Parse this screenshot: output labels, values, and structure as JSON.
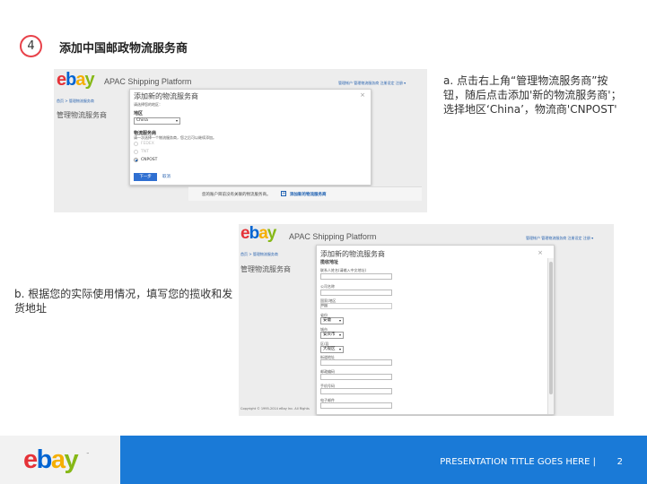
{
  "step": {
    "number": "4",
    "title": "添加中国邮政物流服务商"
  },
  "screenshot1": {
    "logo": {
      "e": "e",
      "b": "b",
      "a": "a",
      "y": "y"
    },
    "platform_name": "APAC Shipping Platform",
    "top_links": "管理帐户   管理物流服务商   注册设定   注册 ▾",
    "breadcrumb": "首页 > 管理物流服务商",
    "page_heading": "管理物流服务商",
    "modal": {
      "title": "添加新的物流服务商",
      "close": "×",
      "hint": "请选择您的地区：",
      "region_label": "地区",
      "region_value": "China",
      "provider_label": "物流服务商",
      "provider_hint": "请一次选择一个物流服务商，您之后可以继续添加。",
      "options": [
        {
          "label": "FEDEX",
          "state": "disabled"
        },
        {
          "label": "TNT",
          "state": "disabled"
        },
        {
          "label": "CNPOST",
          "state": "selected"
        }
      ],
      "next_button": "下一步",
      "cancel_button": "取消"
    },
    "footer_text": "您的账户目前没有关联的物流服务商。",
    "footer_link": "添加新的物流服务商",
    "footer_plus": "+"
  },
  "screenshot2": {
    "logo": {
      "e": "e",
      "b": "b",
      "a": "a",
      "y": "y"
    },
    "platform_name": "APAC Shipping Platform",
    "top_links": "管理帐户   管理物流服务商   注册设定   注册 ▾",
    "breadcrumb": "首页 > 管理物流服务商",
    "page_heading": "管理物流服务商",
    "modal": {
      "title": "添加新的物流服务商",
      "close": "×",
      "section_heading": "揽收地址",
      "field_contact": "联系人姓名(请输入中文地址)",
      "field_company": "公司名称",
      "field_country": "国家/地区",
      "country_value": "中国",
      "field_province": "省份",
      "province_value": "安徽",
      "field_city": "城市",
      "city_value": "安庆市",
      "field_district": "区/县",
      "district_value": "大观区",
      "field_street": "街道地址",
      "field_postcode": "邮政编码",
      "field_mobile": "手机号码",
      "field_email": "电子邮件"
    },
    "copyright": "Copyright © 1995-2014 eBay Inc. All Rights"
  },
  "annotation_a": "a. 点击右上角“管理物流服务商”按钮，随后点击添加'新的物流服务商'；选择地区‘China’，物流商'CNPOST'",
  "annotation_b": "b. 根据您的实际使用情况，填写您的揽收和发货地址",
  "footer": {
    "logo": {
      "e": "e",
      "b": "b",
      "a": "a",
      "y": "y"
    },
    "trademark": "™",
    "presentation_title": "PRESENTATION TITLE GOES HERE |",
    "page_number": "2"
  },
  "colors": {
    "accent_blue": "#1a7ad7",
    "badge_red": "#e8424a",
    "ebay_red": "#e53238",
    "ebay_blue": "#0064d2",
    "ebay_yellow": "#f5af02",
    "ebay_green": "#86b817"
  }
}
